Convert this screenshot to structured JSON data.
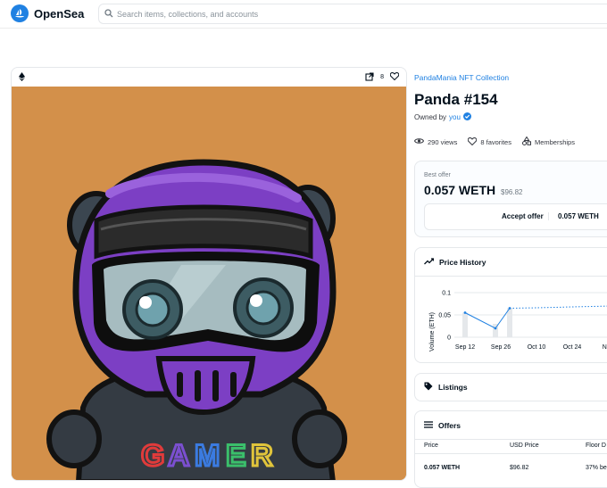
{
  "header": {
    "brand": "OpenSea",
    "search_placeholder": "Search items, collections, and accounts"
  },
  "media": {
    "chain_icon": "ethereum-icon",
    "favorite_count": "8",
    "background_color": "#d3904a"
  },
  "item": {
    "collection": "PandaMania NFT Collection",
    "title": "Panda #154",
    "owned_by_label": "Owned by",
    "owner": "you",
    "views": "290 views",
    "favorites": "8 favorites",
    "memberships": "Memberships"
  },
  "offer": {
    "label": "Best offer",
    "value": "0.057 WETH",
    "usd": "$96.82",
    "accept_label": "Accept offer",
    "accept_value": "0.057 WETH"
  },
  "price_history": {
    "title": "Price History",
    "ylabel": "Volume (ETH)",
    "ticks_y": [
      "0.1",
      "0.05",
      "0"
    ],
    "ticks_x": [
      "Sep 12",
      "Sep 26",
      "Oct 10",
      "Oct 24",
      "Nov"
    ]
  },
  "listings": {
    "title": "Listings"
  },
  "offers": {
    "title": "Offers",
    "columns": [
      "Price",
      "USD Price",
      "Floor D"
    ],
    "rows": [
      {
        "price": "0.057 WETH",
        "usd": "$96.82",
        "floor": "37% be"
      }
    ]
  },
  "chart_data": {
    "type": "line",
    "title": "Price History",
    "ylabel": "Volume (ETH)",
    "xlabel": "",
    "x": [
      "Sep 12",
      "Sep 26",
      "Oct 10",
      "Oct 24",
      "Nov"
    ],
    "ylim": [
      0,
      0.1
    ],
    "series": [
      {
        "values": [
          0.055,
          0.02,
          0.065,
          0.068,
          0.07
        ]
      }
    ],
    "volume_bars": [
      0.055,
      0.03,
      0.065
    ],
    "grid": true
  },
  "colors": {
    "accent": "#2081e2",
    "text": "#04111d",
    "muted": "#707a83"
  }
}
